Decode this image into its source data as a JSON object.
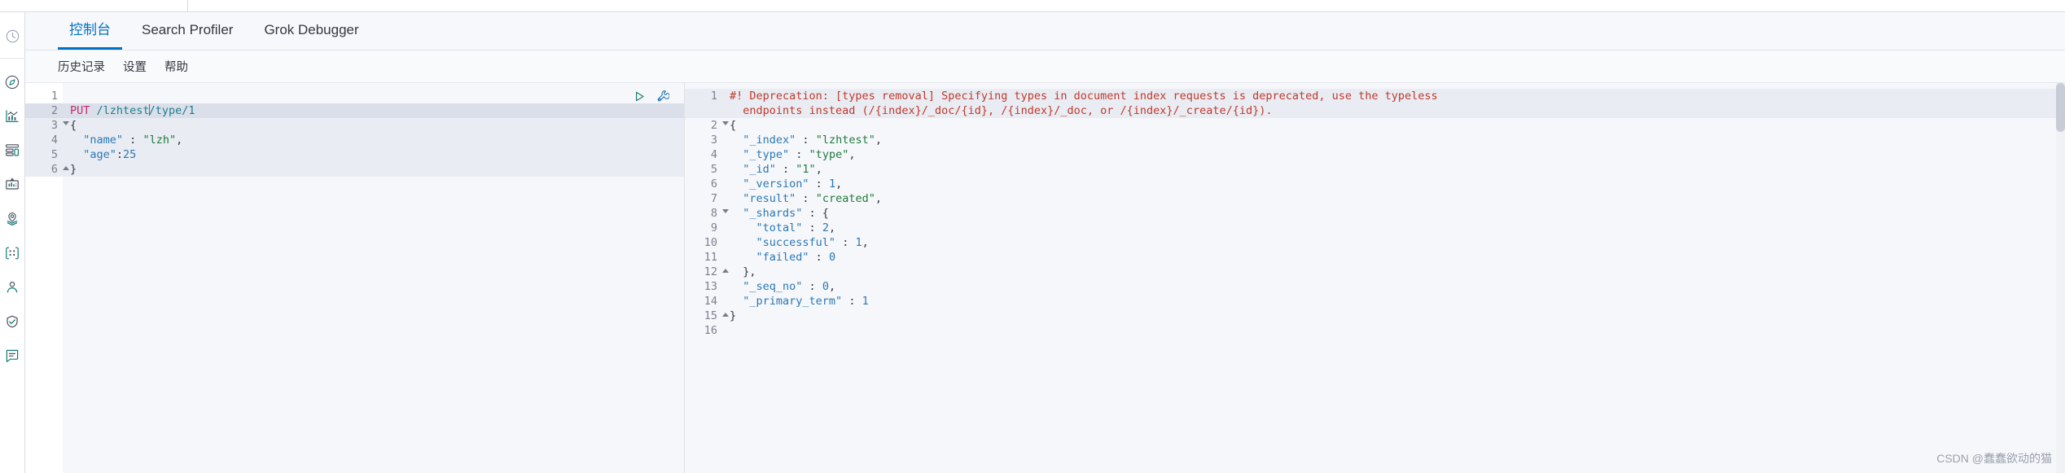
{
  "rail": {
    "items": [
      {
        "name": "recently-viewed-icon",
        "label": "Recently viewed"
      },
      {
        "name": "discover-icon",
        "label": "Discover"
      },
      {
        "name": "visualize-icon",
        "label": "Visualize"
      },
      {
        "name": "dashboard-icon",
        "label": "Dashboard"
      },
      {
        "name": "canvas-icon",
        "label": "Canvas"
      },
      {
        "name": "maps-icon",
        "label": "Maps"
      },
      {
        "name": "machine-learning-icon",
        "label": "Machine Learning"
      },
      {
        "name": "infrastructure-icon",
        "label": "Infrastructure"
      },
      {
        "name": "uptime-icon",
        "label": "Uptime"
      },
      {
        "name": "apm-icon",
        "label": "APM"
      }
    ]
  },
  "tabs": [
    {
      "label": "控制台",
      "active": true
    },
    {
      "label": "Search Profiler",
      "active": false
    },
    {
      "label": "Grok Debugger",
      "active": false
    }
  ],
  "submenu": [
    {
      "label": "历史记录"
    },
    {
      "label": "设置"
    },
    {
      "label": "帮助"
    }
  ],
  "editor": {
    "actions": [
      {
        "name": "run-request-button",
        "label": "▷"
      },
      {
        "name": "wrench-menu-button",
        "label": "wrench"
      }
    ],
    "lines": [
      {
        "num": "1",
        "state": "plain",
        "fold": "",
        "tokens": []
      },
      {
        "num": "2",
        "state": "highlight",
        "fold": "",
        "tokens": [
          {
            "cls": "t-method",
            "text": "PUT"
          },
          {
            "cls": "t-plain",
            "text": " "
          },
          {
            "cls": "t-url",
            "text": "/lzhtest"
          },
          {
            "cls": "caret",
            "text": ""
          },
          {
            "cls": "t-url",
            "text": "/type/1"
          }
        ]
      },
      {
        "num": "3",
        "state": "tint",
        "fold": "down",
        "tokens": [
          {
            "cls": "t-punct",
            "text": "{"
          }
        ]
      },
      {
        "num": "4",
        "state": "tint",
        "fold": "",
        "tokens": [
          {
            "cls": "t-plain",
            "text": "  "
          },
          {
            "cls": "t-key",
            "text": "\"name\""
          },
          {
            "cls": "t-punct",
            "text": " : "
          },
          {
            "cls": "t-str",
            "text": "\"lzh\""
          },
          {
            "cls": "t-punct",
            "text": ","
          }
        ]
      },
      {
        "num": "5",
        "state": "tint",
        "fold": "",
        "tokens": [
          {
            "cls": "t-plain",
            "text": "  "
          },
          {
            "cls": "t-key",
            "text": "\"age\""
          },
          {
            "cls": "t-punct",
            "text": ":"
          },
          {
            "cls": "t-num",
            "text": "25"
          }
        ]
      },
      {
        "num": "6",
        "state": "tint",
        "fold": "up",
        "tokens": [
          {
            "cls": "t-punct",
            "text": "}"
          }
        ]
      }
    ]
  },
  "response": {
    "lines": [
      {
        "num": "1",
        "state": "tint",
        "fold": "",
        "tokens": [
          {
            "cls": "t-warn",
            "text": "#! Deprecation: [types removal] Specifying types in document index requests is deprecated, use the typeless"
          }
        ]
      },
      {
        "num": "",
        "state": "tint",
        "fold": "",
        "tokens": [
          {
            "cls": "t-warn",
            "text": "  endpoints instead (/{index}/_doc/{id}, /{index}/_doc, or /{index}/_create/{id})."
          }
        ]
      },
      {
        "num": "2",
        "state": "plain",
        "fold": "down",
        "tokens": [
          {
            "cls": "t-punct",
            "text": "{"
          }
        ]
      },
      {
        "num": "3",
        "state": "plain",
        "fold": "",
        "tokens": [
          {
            "cls": "t-plain",
            "text": "  "
          },
          {
            "cls": "t-key",
            "text": "\"_index\""
          },
          {
            "cls": "t-punct",
            "text": " : "
          },
          {
            "cls": "t-str",
            "text": "\"lzhtest\""
          },
          {
            "cls": "t-punct",
            "text": ","
          }
        ]
      },
      {
        "num": "4",
        "state": "plain",
        "fold": "",
        "tokens": [
          {
            "cls": "t-plain",
            "text": "  "
          },
          {
            "cls": "t-key",
            "text": "\"_type\""
          },
          {
            "cls": "t-punct",
            "text": " : "
          },
          {
            "cls": "t-str",
            "text": "\"type\""
          },
          {
            "cls": "t-punct",
            "text": ","
          }
        ]
      },
      {
        "num": "5",
        "state": "plain",
        "fold": "",
        "tokens": [
          {
            "cls": "t-plain",
            "text": "  "
          },
          {
            "cls": "t-key",
            "text": "\"_id\""
          },
          {
            "cls": "t-punct",
            "text": " : "
          },
          {
            "cls": "t-str",
            "text": "\"1\""
          },
          {
            "cls": "t-punct",
            "text": ","
          }
        ]
      },
      {
        "num": "6",
        "state": "plain",
        "fold": "",
        "tokens": [
          {
            "cls": "t-plain",
            "text": "  "
          },
          {
            "cls": "t-key",
            "text": "\"_version\""
          },
          {
            "cls": "t-punct",
            "text": " : "
          },
          {
            "cls": "t-num",
            "text": "1"
          },
          {
            "cls": "t-punct",
            "text": ","
          }
        ]
      },
      {
        "num": "7",
        "state": "plain",
        "fold": "",
        "tokens": [
          {
            "cls": "t-plain",
            "text": "  "
          },
          {
            "cls": "t-key",
            "text": "\"result\""
          },
          {
            "cls": "t-punct",
            "text": " : "
          },
          {
            "cls": "t-str",
            "text": "\"created\""
          },
          {
            "cls": "t-punct",
            "text": ","
          }
        ]
      },
      {
        "num": "8",
        "state": "plain",
        "fold": "down",
        "tokens": [
          {
            "cls": "t-plain",
            "text": "  "
          },
          {
            "cls": "t-key",
            "text": "\"_shards\""
          },
          {
            "cls": "t-punct",
            "text": " : {"
          }
        ]
      },
      {
        "num": "9",
        "state": "plain",
        "fold": "",
        "tokens": [
          {
            "cls": "t-plain",
            "text": "    "
          },
          {
            "cls": "t-key",
            "text": "\"total\""
          },
          {
            "cls": "t-punct",
            "text": " : "
          },
          {
            "cls": "t-num",
            "text": "2"
          },
          {
            "cls": "t-punct",
            "text": ","
          }
        ]
      },
      {
        "num": "10",
        "state": "plain",
        "fold": "",
        "tokens": [
          {
            "cls": "t-plain",
            "text": "    "
          },
          {
            "cls": "t-key",
            "text": "\"successful\""
          },
          {
            "cls": "t-punct",
            "text": " : "
          },
          {
            "cls": "t-num",
            "text": "1"
          },
          {
            "cls": "t-punct",
            "text": ","
          }
        ]
      },
      {
        "num": "11",
        "state": "plain",
        "fold": "",
        "tokens": [
          {
            "cls": "t-plain",
            "text": "    "
          },
          {
            "cls": "t-key",
            "text": "\"failed\""
          },
          {
            "cls": "t-punct",
            "text": " : "
          },
          {
            "cls": "t-num",
            "text": "0"
          }
        ]
      },
      {
        "num": "12",
        "state": "plain",
        "fold": "up",
        "tokens": [
          {
            "cls": "t-punct",
            "text": "  },"
          }
        ]
      },
      {
        "num": "13",
        "state": "plain",
        "fold": "",
        "tokens": [
          {
            "cls": "t-plain",
            "text": "  "
          },
          {
            "cls": "t-key",
            "text": "\"_seq_no\""
          },
          {
            "cls": "t-punct",
            "text": " : "
          },
          {
            "cls": "t-num",
            "text": "0"
          },
          {
            "cls": "t-punct",
            "text": ","
          }
        ]
      },
      {
        "num": "14",
        "state": "plain",
        "fold": "",
        "tokens": [
          {
            "cls": "t-plain",
            "text": "  "
          },
          {
            "cls": "t-key",
            "text": "\"_primary_term\""
          },
          {
            "cls": "t-punct",
            "text": " : "
          },
          {
            "cls": "t-num",
            "text": "1"
          }
        ]
      },
      {
        "num": "15",
        "state": "plain",
        "fold": "up",
        "tokens": [
          {
            "cls": "t-punct",
            "text": "}"
          }
        ]
      },
      {
        "num": "16",
        "state": "plain",
        "fold": "",
        "tokens": []
      }
    ]
  },
  "watermark": {
    "text": "CSDN @蠢蠢欲动的猫"
  },
  "colors": {
    "accent": "#0071c2",
    "method": "#c9276f",
    "url": "#1a7f8e",
    "key": "#2a78b4",
    "string": "#1f7a3d",
    "warning": "#c0392b",
    "run_icon": "#1a7f6e"
  }
}
